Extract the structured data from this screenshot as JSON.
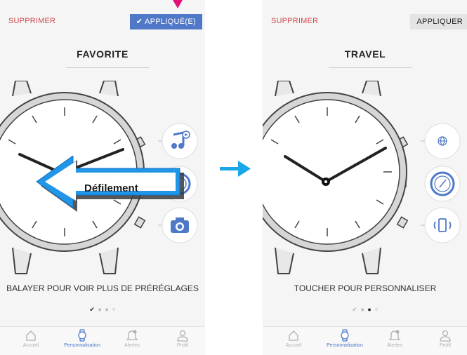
{
  "left_screen": {
    "delete_label": "SUPPRIMER",
    "apply_label": "✔ APPLIQUÉ(E)",
    "title": "FAVORITE",
    "caption": "BALAYER POUR VOIR PLUS DE PRÉRÉGLAGES",
    "pager": [
      "✔",
      "●",
      "●",
      "+"
    ],
    "complications": [
      "music-icon",
      "watch-icon",
      "camera-icon"
    ],
    "overlay_label": "Défilement"
  },
  "right_screen": {
    "delete_label": "SUPPRIMER",
    "apply_label": "APPLIQUER",
    "title": "TRAVEL",
    "caption": "TOUCHER POUR PERSONNALISER",
    "pager": [
      "✔",
      "●",
      "●",
      "+"
    ],
    "complications": [
      "globe-icon",
      "gauge-icon",
      "phone-vibrate-icon"
    ]
  },
  "tabs": [
    {
      "label": "Accueil",
      "icon": "home-icon"
    },
    {
      "label": "Personnalisation",
      "icon": "watch-icon"
    },
    {
      "label": "Alertes",
      "icon": "bell-icon"
    },
    {
      "label": "Profil",
      "icon": "person-icon"
    }
  ],
  "colors": {
    "accent": "#4f78c8",
    "delete": "#d0474f",
    "arrow": "#1aa6e8",
    "pointer": "#e0127a"
  }
}
